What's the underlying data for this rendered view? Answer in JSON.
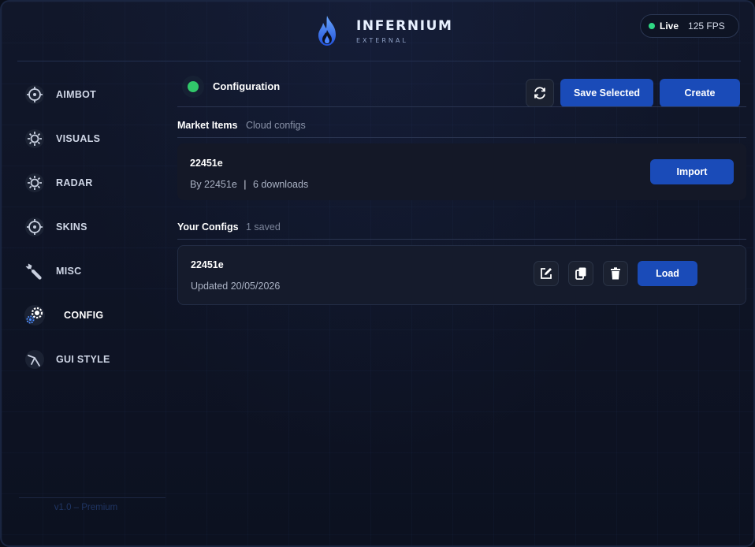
{
  "header": {
    "brand_title": "INFERNIUM",
    "brand_subtitle": "EXTERNAL",
    "live_label": "Live",
    "fps": "125 FPS"
  },
  "sidebar": {
    "items": [
      {
        "label": "AIMBOT",
        "icon": "crosshair-icon",
        "active": false
      },
      {
        "label": "VISUALS",
        "icon": "sun-icon",
        "active": false
      },
      {
        "label": "RADAR",
        "icon": "radar-icon",
        "active": false
      },
      {
        "label": "SKINS",
        "icon": "crosshair-icon",
        "active": false
      },
      {
        "label": "MISC",
        "icon": "wrench-icon",
        "active": false
      },
      {
        "label": "CONFIG",
        "icon": "gears-icon",
        "active": true
      },
      {
        "label": "GUI STYLE",
        "icon": "brush-icon",
        "active": false
      }
    ],
    "version": "v1.0 – Premium"
  },
  "main": {
    "title": "Configuration",
    "status_color": "#31c86a",
    "refresh_icon": "refresh-icon",
    "save_selected_label": "Save Selected",
    "create_label": "Create",
    "tabs": [
      {
        "label": "Market Items",
        "active": true
      },
      {
        "label": "Cloud configs",
        "active": false
      }
    ],
    "market_item": {
      "name": "22451e",
      "author": "By 22451e",
      "separator": "|",
      "downloads": "6 downloads",
      "import_label": "Import"
    },
    "your_configs": {
      "title": "Your Configs",
      "count": "1 saved",
      "items": [
        {
          "name": "22451e",
          "updated": "Updated 20/05/2026",
          "load_label": "Load"
        }
      ]
    }
  },
  "colors": {
    "accent": "#1a4bb8",
    "live_green": "#2fd884",
    "background": "#0c1120"
  }
}
